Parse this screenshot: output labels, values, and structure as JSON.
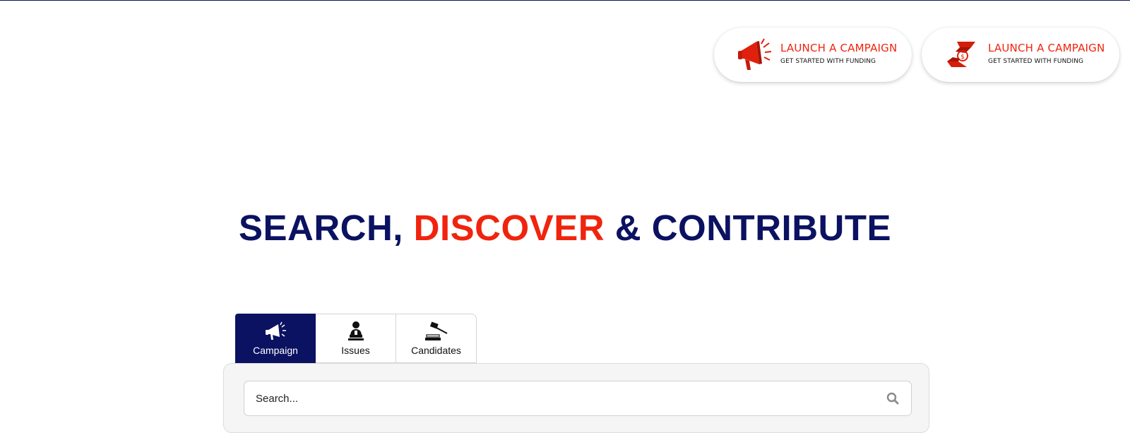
{
  "header": {
    "ctas": [
      {
        "title": "LAUNCH A CAMPAIGN",
        "subtitle": "GET STARTED WITH FUNDING",
        "icon": "megaphone-icon"
      },
      {
        "title": "LAUNCH A CAMPAIGN",
        "subtitle": "GET STARTED WITH FUNDING",
        "icon": "hands-money-icon"
      }
    ]
  },
  "hero": {
    "part1": "SEARCH, ",
    "part2": "DISCOVER",
    "part3": " & CONTRIBUTE"
  },
  "tabs": [
    {
      "label": "Campaign",
      "icon": "megaphone-icon",
      "active": true
    },
    {
      "label": "Issues",
      "icon": "speaker-podium-icon",
      "active": false
    },
    {
      "label": "Candidates",
      "icon": "gavel-icon",
      "active": false
    }
  ],
  "search": {
    "placeholder": "Search...",
    "value": ""
  },
  "colors": {
    "navy": "#0b1261",
    "accent": "#f0240e"
  }
}
